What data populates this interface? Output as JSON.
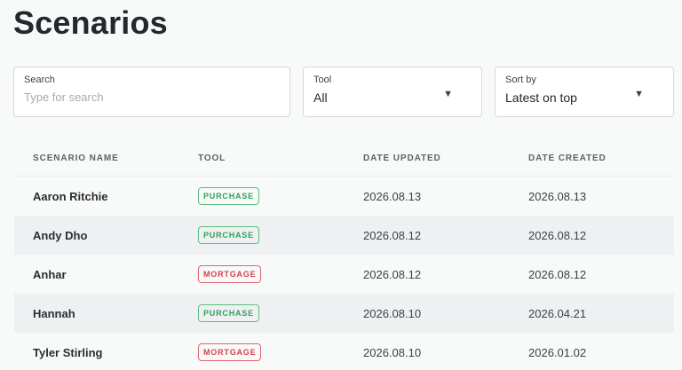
{
  "page_title": "Scenarios",
  "filters": {
    "search": {
      "label": "Search",
      "placeholder": "Type for search",
      "value": ""
    },
    "tool": {
      "label": "Tool",
      "value": "All"
    },
    "sort": {
      "label": "Sort by",
      "value": "Latest on top"
    }
  },
  "table": {
    "headers": [
      "SCENARIO NAME",
      "TOOL",
      "DATE UPDATED",
      "DATE CREATED"
    ],
    "rows": [
      {
        "name": "Aaron Ritchie",
        "tool": "PURCHASE",
        "updated": "2026.08.13",
        "created": "2026.08.13"
      },
      {
        "name": "Andy Dho",
        "tool": "PURCHASE",
        "updated": "2026.08.12",
        "created": "2026.08.12"
      },
      {
        "name": "Anhar",
        "tool": "MORTGAGE",
        "updated": "2026.08.12",
        "created": "2026.08.12"
      },
      {
        "name": "Hannah",
        "tool": "PURCHASE",
        "updated": "2026.08.10",
        "created": "2026.04.21"
      },
      {
        "name": "Tyler Stirling",
        "tool": "MORTGAGE",
        "updated": "2026.08.10",
        "created": "2026.01.02"
      }
    ]
  },
  "colors": {
    "purchase": "#2ea35a",
    "mortgage": "#d1434f",
    "row_alt": "#eff0f2"
  },
  "icons": {
    "dropdown": "caret-down-icon"
  }
}
